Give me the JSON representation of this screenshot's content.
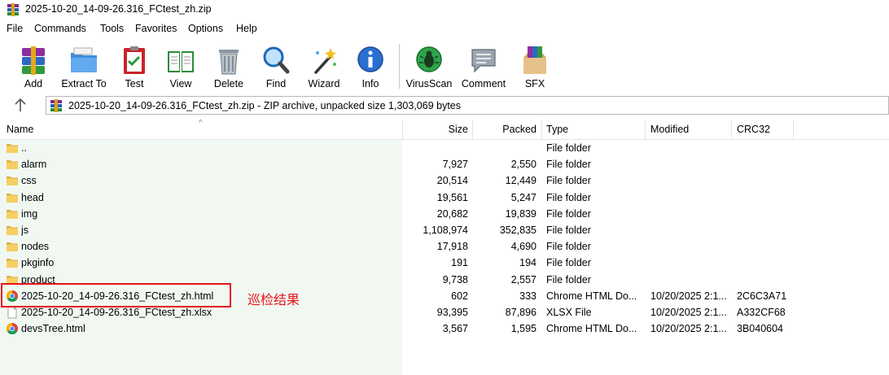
{
  "window": {
    "title": "2025-10-20_14-09-26.316_FCtest_zh.zip",
    "app_icon": "winrar-icon"
  },
  "menu": [
    "File",
    "Commands",
    "Tools",
    "Favorites",
    "Options",
    "Help"
  ],
  "toolbar": [
    {
      "label": "Add",
      "icon": "add-books-icon"
    },
    {
      "label": "Extract To",
      "icon": "extract-folder-icon"
    },
    {
      "label": "Test",
      "icon": "test-clipboard-icon"
    },
    {
      "label": "View",
      "icon": "view-book-icon"
    },
    {
      "label": "Delete",
      "icon": "trash-icon"
    },
    {
      "label": "Find",
      "icon": "magnifier-icon"
    },
    {
      "label": "Wizard",
      "icon": "magic-wand-icon"
    },
    {
      "label": "Info",
      "icon": "info-icon"
    },
    {
      "label": "VirusScan",
      "icon": "bug-scan-icon"
    },
    {
      "label": "Comment",
      "icon": "comment-icon"
    },
    {
      "label": "SFX",
      "icon": "sfx-box-icon"
    }
  ],
  "address": {
    "text": "2025-10-20_14-09-26.316_FCtest_zh.zip - ZIP archive, unpacked size 1,303,069 bytes"
  },
  "columns": {
    "name": "Name",
    "size": "Size",
    "packed": "Packed",
    "type": "Type",
    "modified": "Modified",
    "crc": "CRC32"
  },
  "files": [
    {
      "name": "..",
      "size": "",
      "packed": "",
      "type": "File folder",
      "modified": "",
      "crc": "",
      "icon": "folder"
    },
    {
      "name": "alarm",
      "size": "7,927",
      "packed": "2,550",
      "type": "File folder",
      "modified": "",
      "crc": "",
      "icon": "folder"
    },
    {
      "name": "css",
      "size": "20,514",
      "packed": "12,449",
      "type": "File folder",
      "modified": "",
      "crc": "",
      "icon": "folder"
    },
    {
      "name": "head",
      "size": "19,561",
      "packed": "5,247",
      "type": "File folder",
      "modified": "",
      "crc": "",
      "icon": "folder"
    },
    {
      "name": "img",
      "size": "20,682",
      "packed": "19,839",
      "type": "File folder",
      "modified": "",
      "crc": "",
      "icon": "folder"
    },
    {
      "name": "js",
      "size": "1,108,974",
      "packed": "352,835",
      "type": "File folder",
      "modified": "",
      "crc": "",
      "icon": "folder"
    },
    {
      "name": "nodes",
      "size": "17,918",
      "packed": "4,690",
      "type": "File folder",
      "modified": "",
      "crc": "",
      "icon": "folder"
    },
    {
      "name": "pkginfo",
      "size": "191",
      "packed": "194",
      "type": "File folder",
      "modified": "",
      "crc": "",
      "icon": "folder"
    },
    {
      "name": "product",
      "size": "9,738",
      "packed": "2,557",
      "type": "File folder",
      "modified": "",
      "crc": "",
      "icon": "folder"
    },
    {
      "name": "2025-10-20_14-09-26.316_FCtest_zh.html",
      "size": "602",
      "packed": "333",
      "type": "Chrome HTML Do...",
      "modified": "10/20/2025 2:1...",
      "crc": "2C6C3A71",
      "icon": "chrome"
    },
    {
      "name": "2025-10-20_14-09-26.316_FCtest_zh.xlsx",
      "size": "93,395",
      "packed": "87,896",
      "type": "XLSX File",
      "modified": "10/20/2025 2:1...",
      "crc": "A332CF68",
      "icon": "file"
    },
    {
      "name": "devsTree.html",
      "size": "3,567",
      "packed": "1,595",
      "type": "Chrome HTML Do...",
      "modified": "10/20/2025 2:1...",
      "crc": "3B040604",
      "icon": "chrome"
    }
  ],
  "annotation": {
    "text": "巡检结果",
    "color": "#e8131b"
  }
}
